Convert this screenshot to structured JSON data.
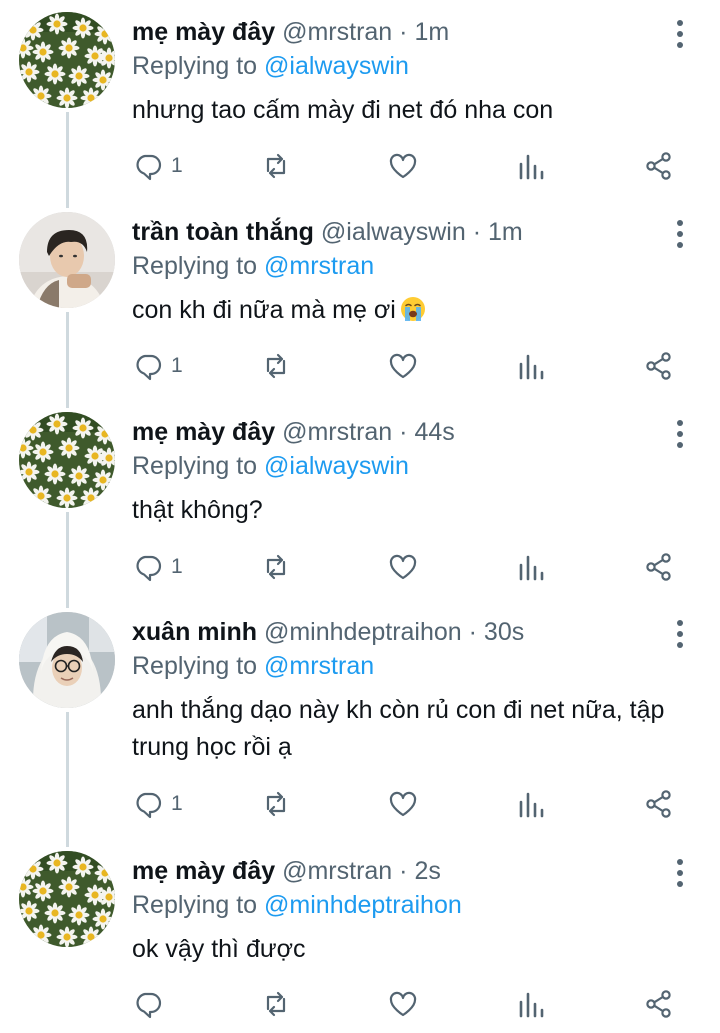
{
  "colors": {
    "link": "#1d9bf0",
    "muted": "#536471",
    "thread_line": "#cfd9de"
  },
  "tweets": [
    {
      "name": "mẹ mày đây",
      "handle": "@mrstran",
      "dot": "·",
      "time": "1m",
      "replying_prefix": "Replying to",
      "replying_handle": "@ialwayswin",
      "text": "nhưng tao cấm mày đi net đó nha con",
      "reply_count": "1",
      "avatar": "daisy-avatar"
    },
    {
      "name": "trần toàn thắng",
      "handle": "@ialwayswin",
      "dot": "·",
      "time": "1m",
      "replying_prefix": "Replying to",
      "replying_handle": "@mrstran",
      "text": "con kh đi nữa mà mẹ ơi",
      "emoji": "loudly-crying-face",
      "reply_count": "1",
      "avatar": "boy-avatar"
    },
    {
      "name": "mẹ mày đây",
      "handle": "@mrstran",
      "dot": "·",
      "time": "44s",
      "replying_prefix": "Replying to",
      "replying_handle": "@ialwayswin",
      "text": "thật không?",
      "reply_count": "1",
      "avatar": "daisy-avatar"
    },
    {
      "name": "xuân minh",
      "handle": "@minhdeptraihon",
      "dot": "·",
      "time": "30s",
      "replying_prefix": "Replying to",
      "replying_handle": "@mrstran",
      "text": "anh thắng dạo này kh còn rủ con đi net nữa, tập trung học rồi ạ",
      "reply_count": "1",
      "avatar": "glasses-boy-avatar"
    },
    {
      "name": "mẹ mày đây",
      "handle": "@mrstran",
      "dot": "·",
      "time": "2s",
      "replying_prefix": "Replying to",
      "replying_handle": "@minhdeptraihon",
      "text": "ok vậy thì được",
      "reply_count": "",
      "avatar": "daisy-avatar"
    }
  ],
  "action_icons": [
    "reply-icon",
    "retweet-icon",
    "like-icon",
    "views-icon",
    "share-icon"
  ]
}
